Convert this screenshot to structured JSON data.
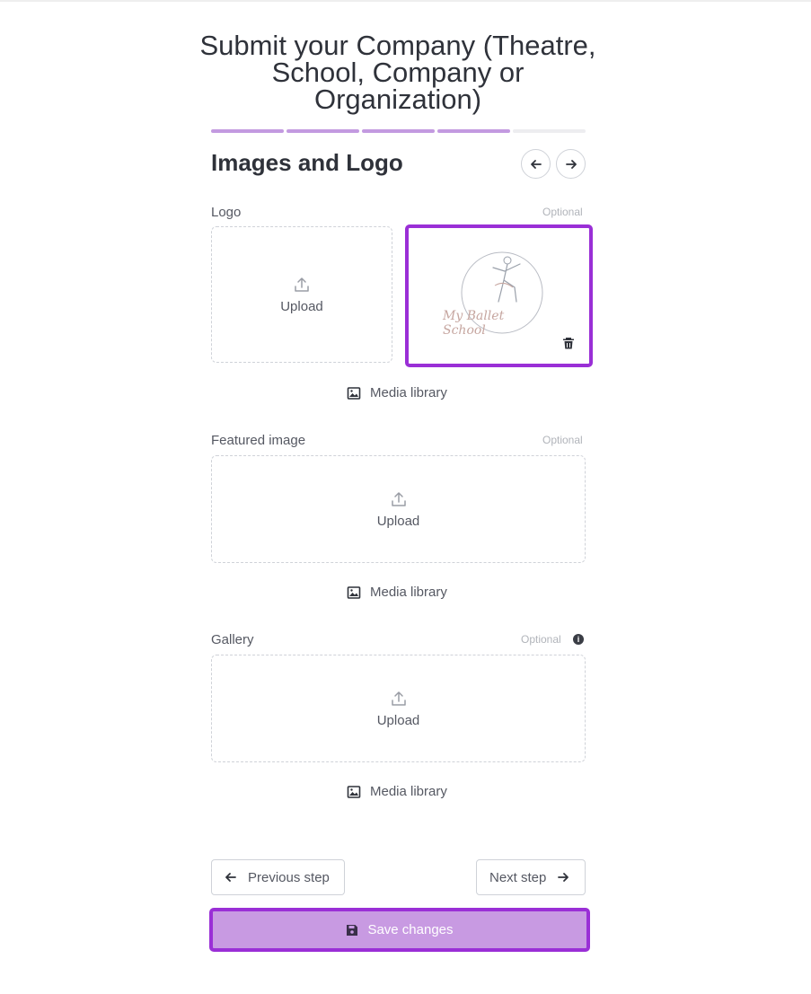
{
  "page": {
    "title_line1": "Submit your Company (Theatre,",
    "title_line2": "School, Company or",
    "title_line3": "Organization)"
  },
  "progress": {
    "completed_steps": 4,
    "total_steps": 5,
    "accent": "#c39ae0"
  },
  "section": {
    "title": "Images and Logo"
  },
  "logo": {
    "label": "Logo",
    "optional": "Optional",
    "upload_label": "Upload",
    "preview_text": "My Ballet School",
    "media_library": "Media library"
  },
  "featured": {
    "label": "Featured image",
    "optional": "Optional",
    "upload_label": "Upload",
    "media_library": "Media library"
  },
  "gallery": {
    "label": "Gallery",
    "optional": "Optional",
    "info": "i",
    "upload_label": "Upload",
    "media_library": "Media library"
  },
  "footer": {
    "previous": "Previous step",
    "next": "Next step",
    "save": "Save changes"
  },
  "colors": {
    "highlight": "#9a2fd6",
    "save_bg": "#c89ae2"
  },
  "icons": [
    "arrow-left-icon",
    "arrow-right-icon",
    "upload-icon",
    "image-icon",
    "trash-icon",
    "save-icon",
    "info-icon"
  ]
}
